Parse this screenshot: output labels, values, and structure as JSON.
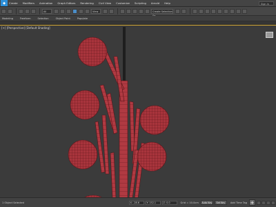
{
  "menubar": {
    "items": [
      "Create",
      "Modifiers",
      "Animation",
      "Graph Editors",
      "Rendering",
      "Civil View",
      "Customize",
      "Scripting",
      "Arnold",
      "Help"
    ],
    "search_label": "Sign in"
  },
  "toolbar": {
    "selection_filter": "All",
    "view_dropdown": "View",
    "named_selection": "Create Selection Se"
  },
  "ribbon": {
    "tabs": [
      "Modeling",
      "Freeform",
      "Selection",
      "Object Paint",
      "Populate"
    ]
  },
  "viewport": {
    "label": "[+] [Perspective] [Default Shading]",
    "model_color": "#a8343c",
    "background_color": "#3b3b3b"
  },
  "statusbar": {
    "left_text": "1 Object Selected",
    "coord_x": "X: -28.6",
    "coord_y": "Y: 152.1",
    "coord_z": "Z: 0.0",
    "grid": "Grid = 10.0cm",
    "autokey_label": "Auto Key",
    "setkey_label": "Set Key",
    "add_time_tag": "Add Time Tag",
    "plus_symbol": "+"
  },
  "colors": {
    "accent": "#d4a935",
    "active_tool": "#4b8ec8"
  }
}
